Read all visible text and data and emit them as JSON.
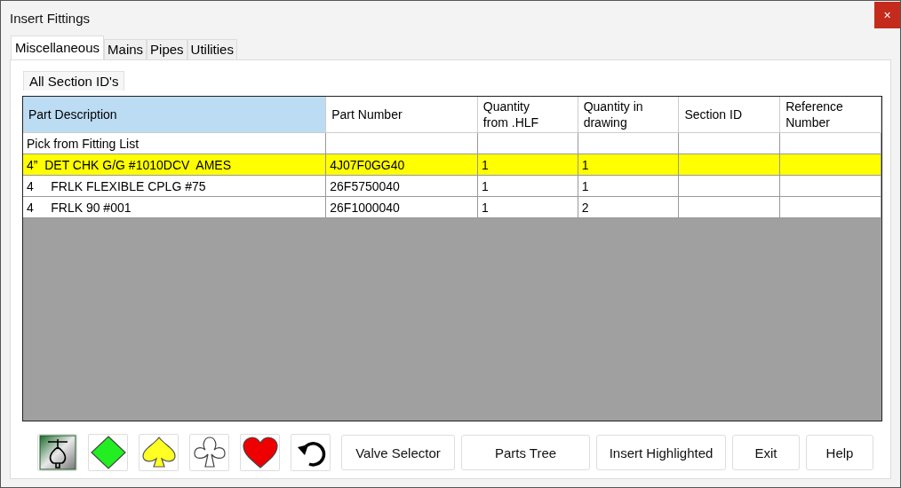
{
  "window": {
    "title": "Insert Fittings",
    "close": "×"
  },
  "tabs": [
    {
      "label": "Miscellaneous",
      "selected": true
    },
    {
      "label": "Mains",
      "selected": false
    },
    {
      "label": "Pipes",
      "selected": false
    },
    {
      "label": "Utilities",
      "selected": false
    }
  ],
  "subtabs": [
    {
      "label": "All Section ID's"
    }
  ],
  "table": {
    "columns": [
      {
        "label": "Part Description",
        "selected": true
      },
      {
        "label": "Part Number",
        "selected": false
      },
      {
        "label": "Quantity from .HLF",
        "selected": false
      },
      {
        "label": "Quantity in drawing",
        "selected": false
      },
      {
        "label": "Section ID",
        "selected": false
      },
      {
        "label": "Reference Number",
        "selected": false
      }
    ],
    "rows": [
      {
        "cells": [
          "Pick from Fitting List",
          "",
          "",
          "",
          "",
          ""
        ],
        "selected": false
      },
      {
        "cells": [
          "4”  DET CHK G/G #1010DCV  AMES",
          "4J07F0GG40",
          "1",
          "1",
          "",
          ""
        ],
        "selected": true
      },
      {
        "cells": [
          "4     FRLK FLEXIBLE CPLG #75",
          "26F5750040",
          "1",
          "1",
          "",
          ""
        ],
        "selected": false
      },
      {
        "cells": [
          "4     FRLK 90 #001",
          "26F1000040",
          "1",
          "2",
          "",
          ""
        ],
        "selected": false
      }
    ]
  },
  "toolbar": [
    {
      "kind": "valve"
    },
    {
      "kind": "diamond"
    },
    {
      "kind": "spade"
    },
    {
      "kind": "club"
    },
    {
      "kind": "heart"
    },
    {
      "kind": "undo"
    }
  ],
  "buttons": [
    "Valve Selector",
    "Parts Tree",
    "Insert Highlighted",
    "Exit",
    "Help"
  ]
}
